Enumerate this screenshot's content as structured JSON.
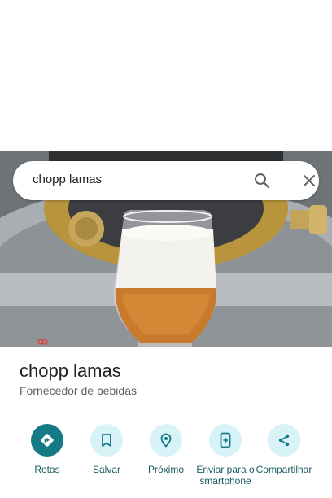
{
  "search": {
    "query": "chopp lamas"
  },
  "place": {
    "title": "chopp lamas",
    "category": "Fornecedor de bebidas"
  },
  "actions": [
    {
      "label": "Rotas",
      "icon": "directions-icon"
    },
    {
      "label": "Salvar",
      "icon": "bookmark-icon"
    },
    {
      "label": "Próximo",
      "icon": "nearby-icon"
    },
    {
      "label": "Enviar para o smartphone",
      "icon": "send-to-phone-icon"
    },
    {
      "label": "Compartilhar",
      "icon": "share-icon"
    }
  ],
  "colors": {
    "accent": "#137a86",
    "action_bg": "#d8f3f7",
    "label": "#1a5c63"
  }
}
